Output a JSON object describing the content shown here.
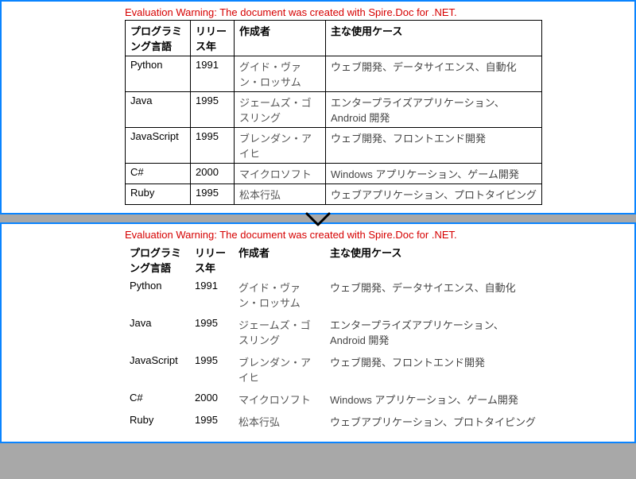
{
  "warning": "Evaluation Warning: The document was created with Spire.Doc for .NET.",
  "headers": {
    "lang": "プログラミング言語",
    "year": "リリース年",
    "creator": "作成者",
    "use": "主な使用ケース"
  },
  "rows": [
    {
      "lang": "Python",
      "year": "1991",
      "creator": "グイド・ヴァン・ロッサム",
      "use": "ウェブ開発、データサイエンス、自動化"
    },
    {
      "lang": "Java",
      "year": "1995",
      "creator": "ジェームズ・ゴスリング",
      "use": "エンタープライズアプリケーション、Android 開発"
    },
    {
      "lang": "JavaScript",
      "year": "1995",
      "creator": "ブレンダン・アイヒ",
      "use": "ウェブ開発、フロントエンド開発"
    },
    {
      "lang": "C#",
      "year": "2000",
      "creator": "マイクロソフト",
      "use": "Windows アプリケーション、ゲーム開発"
    },
    {
      "lang": "Ruby",
      "year": "1995",
      "creator": "松本行弘",
      "use": "ウェブアプリケーション、プロトタイピング"
    }
  ]
}
